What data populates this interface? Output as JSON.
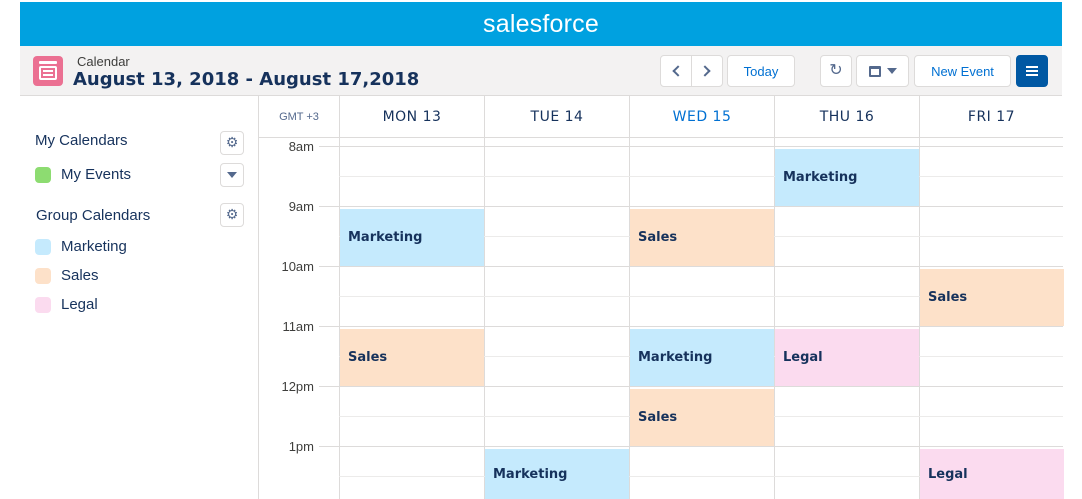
{
  "brand": {
    "logo": "salesforce"
  },
  "header": {
    "subtitle": "Calendar",
    "title": "August 13, 2018 - August 17,2018",
    "today_label": "Today",
    "new_event_label": "New Event"
  },
  "sidebar": {
    "my_calendars_heading": "My Calendars",
    "my_calendars": [
      {
        "label": "My Events",
        "color": "#8ddc71"
      }
    ],
    "group_calendars_heading": "Group Calendars",
    "group_calendars": [
      {
        "label": "Marketing",
        "color": "#c5eafd"
      },
      {
        "label": "Sales",
        "color": "#fde1c9"
      },
      {
        "label": "Legal",
        "color": "#fbdbef"
      }
    ]
  },
  "calendar": {
    "timezone": "GMT +3",
    "days": [
      {
        "label": "MON 13",
        "today": false
      },
      {
        "label": "TUE 14",
        "today": false
      },
      {
        "label": "WED 15",
        "today": true
      },
      {
        "label": "THU 16",
        "today": false
      },
      {
        "label": "FRI 17",
        "today": false
      }
    ],
    "hours": [
      "8am",
      "9am",
      "10am",
      "11am",
      "12pm",
      "1pm"
    ],
    "events": [
      {
        "day": 3,
        "start": 8.0,
        "end": 9.0,
        "label": "Marketing",
        "calendar": "marketing"
      },
      {
        "day": 0,
        "start": 9.0,
        "end": 10.0,
        "label": "Marketing",
        "calendar": "marketing"
      },
      {
        "day": 2,
        "start": 9.0,
        "end": 10.0,
        "label": "Sales",
        "calendar": "sales"
      },
      {
        "day": 4,
        "start": 10.0,
        "end": 11.0,
        "label": "Sales",
        "calendar": "sales"
      },
      {
        "day": 0,
        "start": 11.0,
        "end": 12.0,
        "label": "Sales",
        "calendar": "sales"
      },
      {
        "day": 2,
        "start": 11.0,
        "end": 12.0,
        "label": "Marketing",
        "calendar": "marketing"
      },
      {
        "day": 3,
        "start": 11.0,
        "end": 12.0,
        "label": "Legal",
        "calendar": "legal"
      },
      {
        "day": 2,
        "start": 12.0,
        "end": 13.0,
        "label": "Sales",
        "calendar": "sales"
      },
      {
        "day": 1,
        "start": 13.0,
        "end": 14.0,
        "label": "Marketing",
        "calendar": "marketing"
      },
      {
        "day": 4,
        "start": 13.0,
        "end": 14.0,
        "label": "Legal",
        "calendar": "legal"
      }
    ]
  },
  "colors": {
    "brand_bar": "#00a1e0",
    "accent": "#0070d2",
    "menu_button": "#0058a3"
  }
}
